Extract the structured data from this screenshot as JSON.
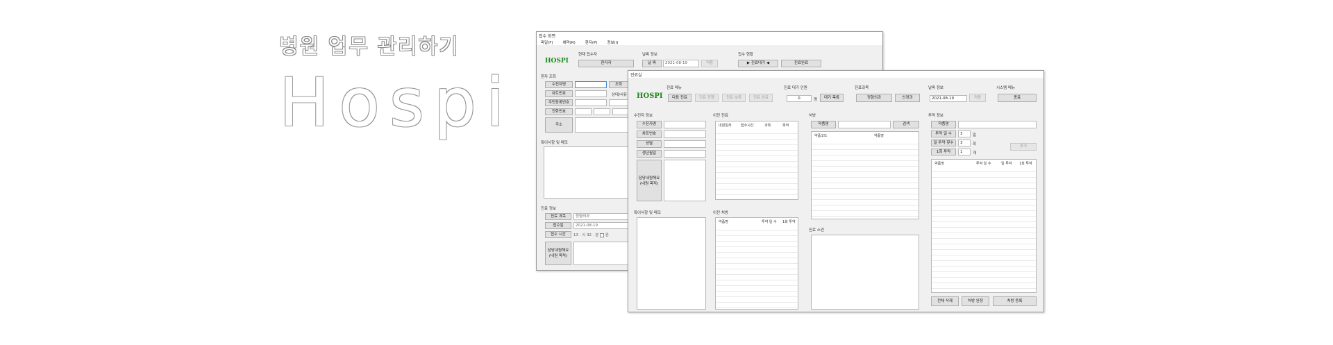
{
  "hero": {
    "title": "병원 업무 관리하기",
    "logo": "Hospi"
  },
  "reception": {
    "title": "접수 화면",
    "menu": [
      "파일(F)",
      "예약(R)",
      "환자(P)",
      "정보(I)"
    ],
    "logo": "HOSPI",
    "group_patient": "현재 접수자",
    "patient_btn": "환자자",
    "group_date": "날짜 정보",
    "today_btn": "날 짜",
    "date": "2021-08-19",
    "date_apply": "적용",
    "group_status": "접수 현황",
    "wait_btn": "▶ 진료대기 ◀",
    "done_btn": "진료완료",
    "search_group": "환자 조회",
    "search_rows": [
      "수진자명",
      "차트번호",
      "주민등록번호",
      "전화번호"
    ],
    "search_btn": "조회",
    "address_label": "주소",
    "status_label": "상태/사유",
    "memo_group": "특이사항 및 메모",
    "visit_group": "진료 정보",
    "visit_dept_label": "진료 과목",
    "visit_dept": "정형외과",
    "visit_date_label": "접수일",
    "visit_date": "2021-08-19",
    "visit_time_label": "접수 시간",
    "visit_hour": "13",
    "visit_hour_unit": "시",
    "visit_min": "32",
    "visit_min_unit": "분",
    "check_label": "완",
    "disease_btn": "담당내원해요\n(내원 목적)"
  },
  "clinic": {
    "title": "진료실",
    "logo": "HOSPI",
    "group_menu": "진료 메뉴",
    "menu_btns": [
      {
        "label": "다음 진료",
        "disabled": false
      },
      {
        "label": "진료 진행",
        "disabled": true
      },
      {
        "label": "진료 보류",
        "disabled": true
      },
      {
        "label": "진료 완료",
        "disabled": true
      }
    ],
    "group_wait": "진료 대기 인원",
    "wait_count": "0",
    "wait_unit": "명",
    "wait_list_btn": "대기 목록",
    "group_dept": "진료과목",
    "dept_btns": [
      "정형외과",
      "신경과"
    ],
    "group_date": "날짜 정보",
    "date": "2021-08-19",
    "date_apply": "적용",
    "group_sys": "시스템 메뉴",
    "sys_btn": "종료",
    "patient_group": "수진자 정보",
    "patient_btns": [
      "수진자명",
      "차트번호",
      "성별",
      "생년월일"
    ],
    "purpose_btn": "담당내원해요\n(내원 목적)",
    "history_group": "이전 진료",
    "history_cols": [
      "내원일자",
      "접수시간",
      "과목",
      "목적"
    ],
    "memo_group": "특이사항 및 메모",
    "prev_rx_group": "이전 처방",
    "prev_rx_cols": [
      "약품명",
      "투약 일 수",
      "1회 투약"
    ],
    "rx_group": "처방",
    "drug_btn": "약품명",
    "search_btn": "검색",
    "drug_cols": [
      "약품코드",
      "약품명"
    ],
    "opinion_group": "진료 소견",
    "dose_group": "투약 정보",
    "dose_drug_btn": "약품명",
    "dose_days_btn": "투약 일 수",
    "dose_days": "3",
    "dose_days_unit": "일",
    "dose_daily_btn": "일 투약 횟수",
    "dose_daily": "3",
    "dose_daily_unit": "회",
    "dose_once_btn": "1회 투약",
    "dose_once": "1",
    "dose_once_unit": "개",
    "dose_add_btn": "추가",
    "dose_cols": [
      "약품명",
      "투약 일 수",
      "일 투약",
      "1회 투약"
    ],
    "bottom_btns": [
      "전체 삭제",
      "처방 완정",
      "처방 등록"
    ]
  }
}
